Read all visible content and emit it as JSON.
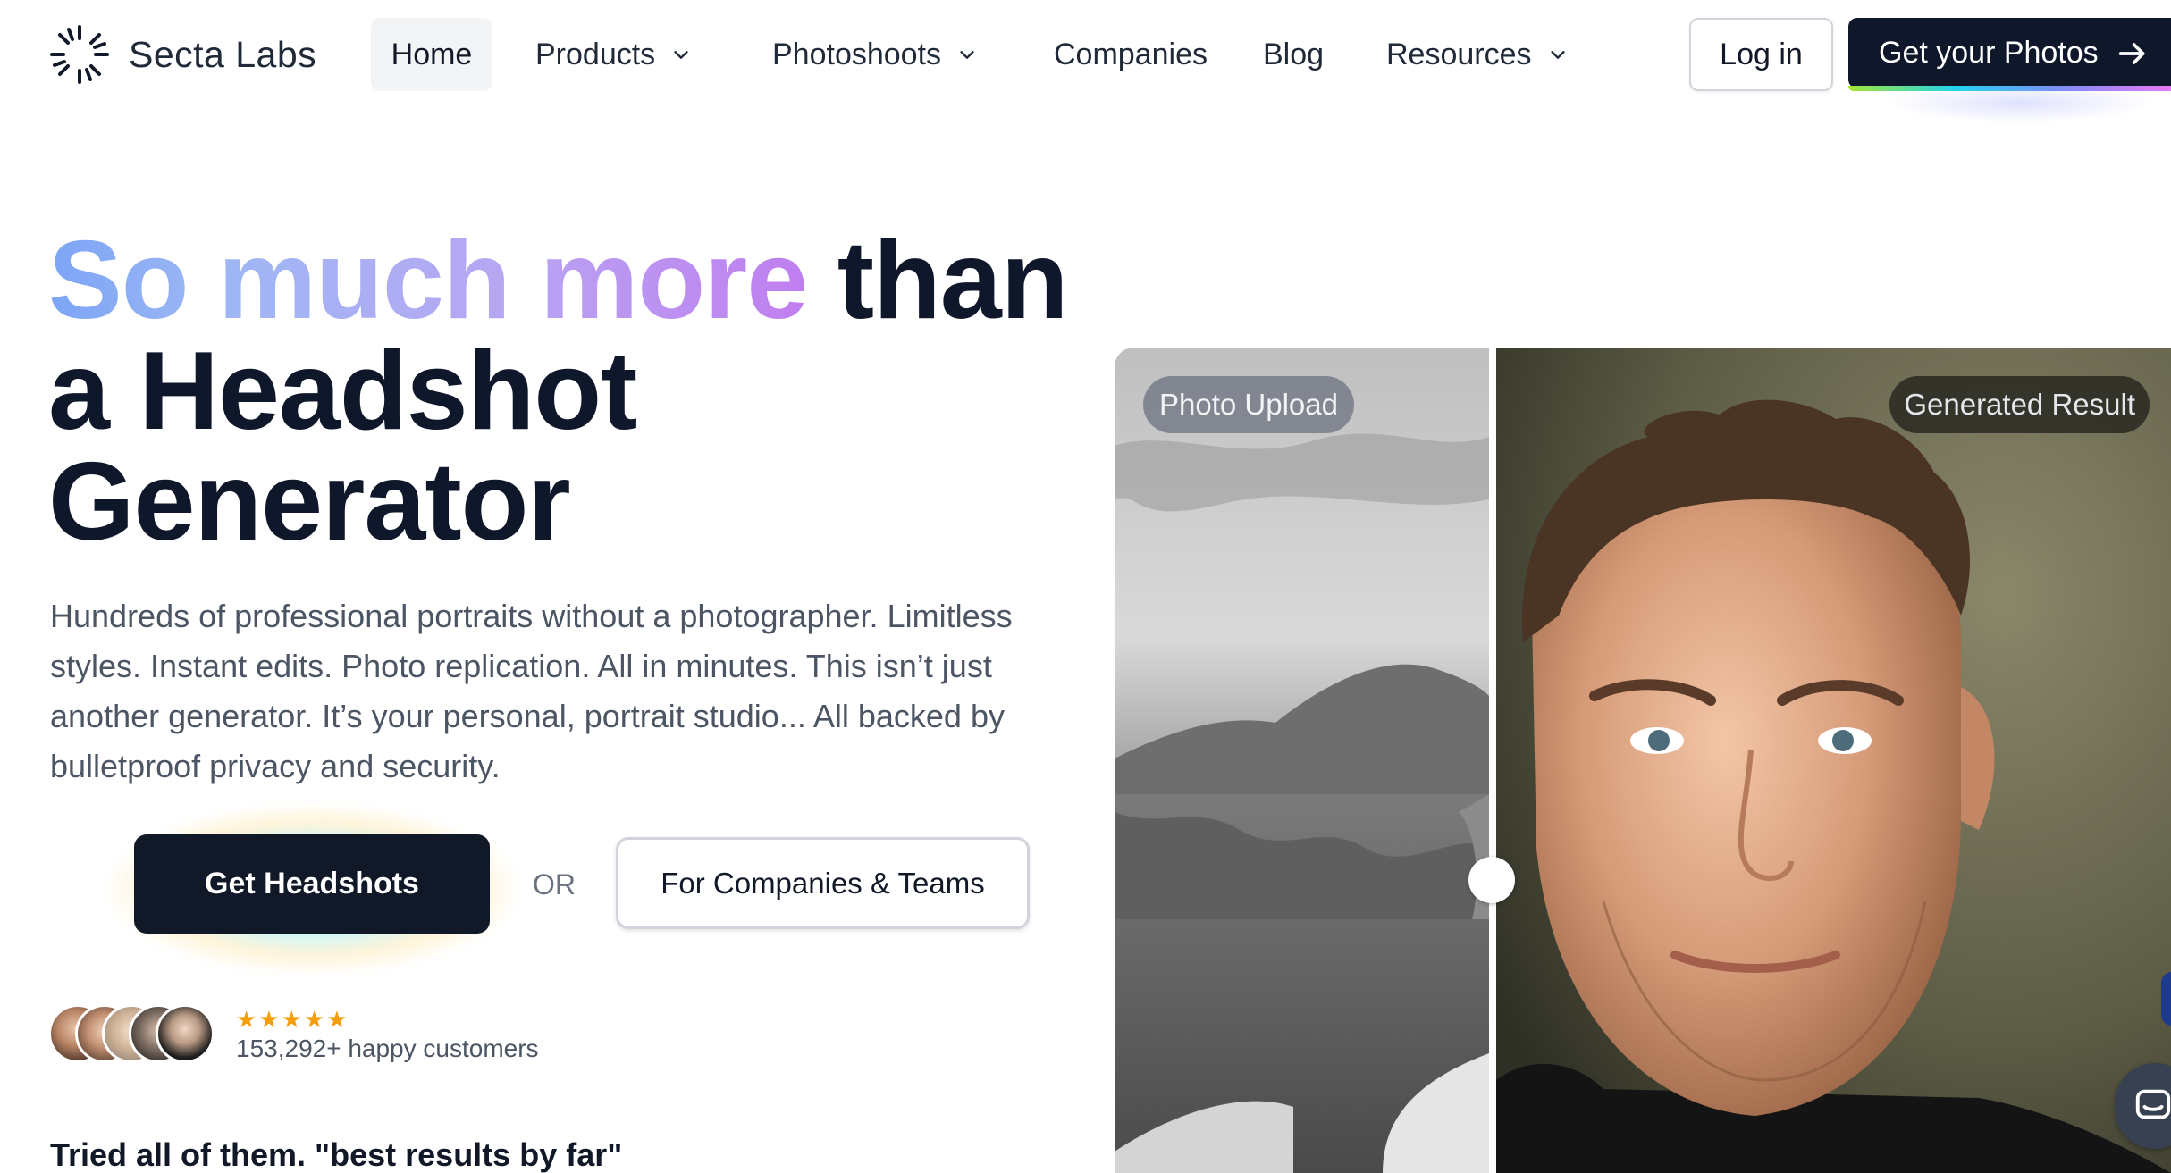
{
  "nav": {
    "logo_text": "Secta Labs",
    "items": [
      {
        "label": "Home",
        "icon": "",
        "active": true
      },
      {
        "label": "Products",
        "icon": "chevron-down-icon"
      },
      {
        "label": "Photoshoots",
        "icon": "chevron-down-icon"
      },
      {
        "label": "Companies",
        "icon": ""
      },
      {
        "label": "Blog",
        "icon": ""
      },
      {
        "label": "Resources",
        "icon": "chevron-down-icon"
      }
    ],
    "login_label": "Log in",
    "cta_label": "Get your Photos",
    "cta_icon": "arrow-right-icon"
  },
  "hero": {
    "title_gradient": "So much more",
    "title_rest_1": "than",
    "title_rest_2": "a Headshot",
    "title_rest_3": "Generator",
    "description": "Hundreds of professional portraits without a photographer. Limitless styles. Instant edits. Photo replication. All in minutes. This isn’t just another generator. It’s your personal, portrait studio... All backed by bulletproof privacy and security.",
    "primary_button": "Get Headshots",
    "or_text": "OR",
    "secondary_button": "For Companies & Teams",
    "stars": "★★★★★",
    "rating": 5,
    "customers": "153,292+ happy customers",
    "testimonial_heading": "Tried all of them. \"best results by far\""
  },
  "compare": {
    "left_label": "Photo Upload",
    "right_label": "Generated Result",
    "slider_position": 0.355
  },
  "colors": {
    "dark": "#0f172a",
    "gradient_start": "#7da4f6",
    "gradient_end": "#c07ef0",
    "star": "#f59e0b"
  }
}
